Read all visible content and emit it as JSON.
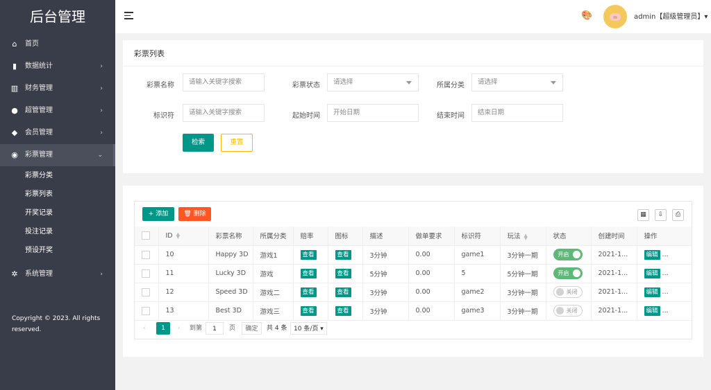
{
  "sidebar": {
    "logo": "后台管理",
    "items": [
      {
        "label": "首页",
        "icon": "home-icon",
        "glyph": "⌂",
        "arrow": ""
      },
      {
        "label": "数据统计",
        "icon": "bar-chart-icon",
        "glyph": "▮",
        "arrow": "›"
      },
      {
        "label": "财务管理",
        "icon": "bank-icon",
        "glyph": "▥",
        "arrow": "›"
      },
      {
        "label": "超管管理",
        "icon": "user-icon",
        "glyph": "●",
        "arrow": "›"
      },
      {
        "label": "会员管理",
        "icon": "users-icon",
        "glyph": "◆",
        "arrow": "›"
      },
      {
        "label": "彩票管理",
        "icon": "gamepad-icon",
        "glyph": "◉",
        "arrow": "⌄"
      }
    ],
    "sub_items": [
      "彩票分类",
      "彩票列表",
      "开奖记录",
      "投注记录",
      "预设开奖"
    ],
    "system": {
      "label": "系统管理",
      "icon": "gear-icon",
      "glyph": "✲",
      "arrow": "›"
    },
    "copyright": "Copyright © 2023. All rights reserved."
  },
  "header": {
    "admin_name": "admin【超级管理员】▾",
    "palette_glyph": "🎨"
  },
  "search": {
    "title": "彩票列表",
    "name_label": "彩票名称",
    "name_placeholder": "请输入关键字搜索",
    "status_label": "彩票状态",
    "status_value": "请选择",
    "category_label": "所属分类",
    "category_value": "请选择",
    "flag_label": "标识符",
    "flag_placeholder": "请输入关键字搜索",
    "start_label": "起始时间",
    "start_placeholder": "开始日期",
    "end_label": "结束时间",
    "end_placeholder": "结束日期",
    "search_button": "检索",
    "reset_button": "重置"
  },
  "table": {
    "add_button": "+ 添加",
    "delete_button": "🗑 删除",
    "columns": [
      "ID",
      "彩票名称",
      "所属分类",
      "赔率",
      "图标",
      "描述",
      "做单要求",
      "标识符",
      "玩法",
      "状态",
      "创建时间",
      "操作"
    ],
    "view_label": "查看",
    "edit_label": "编辑",
    "rows": [
      {
        "id": "10",
        "name": "Happy 3D",
        "category": "游戏1",
        "desc": "3分钟",
        "req": "0.00",
        "flag": "game1",
        "play": "3分钟一期",
        "status": "开启",
        "status_on": true,
        "created": "2021-1...",
        "more": "..."
      },
      {
        "id": "11",
        "name": "Lucky 3D",
        "category": "游戏",
        "desc": "5分钟",
        "req": "0.00",
        "flag": "5",
        "play": "5分钟一期",
        "status": "开启",
        "status_on": true,
        "created": "2021-1...",
        "more": "..."
      },
      {
        "id": "12",
        "name": "Speed 3D",
        "category": "游戏二",
        "desc": "3分钟",
        "req": "0.00",
        "flag": "game2",
        "play": "3分钟一期",
        "status": "关闭",
        "status_on": false,
        "created": "2021-1...",
        "more": "..."
      },
      {
        "id": "13",
        "name": "Best 3D",
        "category": "游戏三",
        "desc": "3分钟",
        "req": "0.00",
        "flag": "game3",
        "play": "3分钟一期",
        "status": "关闭",
        "status_on": false,
        "created": "2021-1...",
        "more": "..."
      }
    ]
  },
  "pager": {
    "prev": "‹",
    "current": "1",
    "next": "›",
    "goto_label": "到第",
    "goto_value": "1",
    "page_label": "页",
    "confirm": "确定",
    "total": "共 4 条",
    "page_size": "10 条/页 ▾"
  }
}
